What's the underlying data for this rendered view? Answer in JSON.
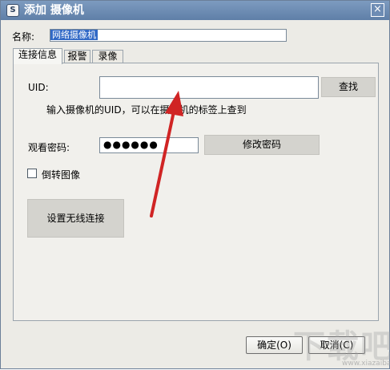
{
  "window": {
    "title": "添加 摄像机",
    "close_glyph": "×"
  },
  "name_field": {
    "label": "名称:",
    "value": "网络摄像机"
  },
  "tabs": [
    {
      "label": "连接信息",
      "active": true
    },
    {
      "label": "报警",
      "active": false
    },
    {
      "label": "录像",
      "active": false
    }
  ],
  "connection": {
    "uid_label": "UID:",
    "uid_value": "",
    "search_button": "查找",
    "uid_hint": "输入摄像机的UID，可以在摄像机的标签上查到",
    "password_label": "观看密码:",
    "password_mask": "●●●●●●",
    "change_password_button": "修改密码",
    "flip_image_label": "倒转图像",
    "flip_image_checked": false,
    "wireless_setup_button": "设置无线连接"
  },
  "footer": {
    "ok_button": "确定(O)",
    "cancel_button": "取消(C)"
  },
  "watermark": {
    "text": "下载吧",
    "url": "www.xiazaiba.com"
  },
  "colors": {
    "annotation_arrow": "#d02424",
    "titlebar": "#6f8db5",
    "selection": "#3169c6"
  }
}
